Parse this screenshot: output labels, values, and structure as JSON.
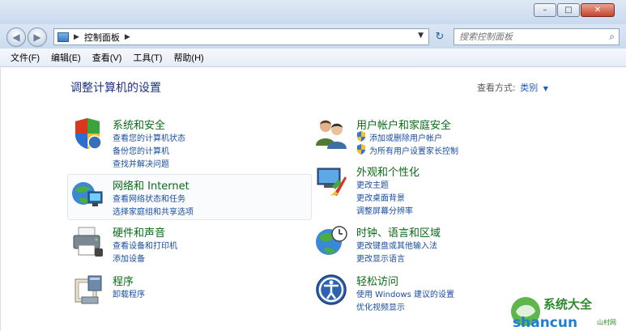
{
  "window": {
    "buttons": {
      "minimize": "–",
      "maximize": "□",
      "close": "✕"
    }
  },
  "address": {
    "breadcrumb": "控制面板",
    "search_placeholder": "搜索控制面板"
  },
  "menu": [
    "文件(F)",
    "编辑(E)",
    "查看(V)",
    "工具(T)",
    "帮助(H)"
  ],
  "page": {
    "title": "调整计算机的设置",
    "view_by_label": "查看方式:",
    "view_by_value": "类别"
  },
  "left": [
    {
      "title": "系统和安全",
      "icon": "shield-icon",
      "links": [
        "查看您的计算机状态",
        "备份您的计算机",
        "查找并解决问题"
      ]
    },
    {
      "title": "网络和 Internet",
      "icon": "network-icon",
      "links": [
        "查看网络状态和任务",
        "选择家庭组和共享选项"
      ]
    },
    {
      "title": "硬件和声音",
      "icon": "printer-icon",
      "links": [
        "查看设备和打印机",
        "添加设备"
      ]
    },
    {
      "title": "程序",
      "icon": "programs-icon",
      "links": [
        "卸载程序"
      ]
    }
  ],
  "right": [
    {
      "title": "用户帐户和家庭安全",
      "icon": "users-icon",
      "links": [
        "添加或删除用户帐户",
        "为所有用户设置家长控制"
      ]
    },
    {
      "title": "外观和个性化",
      "icon": "appearance-icon",
      "links": [
        "更改主题",
        "更改桌面背景",
        "调整屏幕分辨率"
      ]
    },
    {
      "title": "时钟、语言和区域",
      "icon": "globe-clock-icon",
      "links": [
        "更改键盘或其他输入法",
        "更改显示语言"
      ]
    },
    {
      "title": "轻松访问",
      "icon": "ease-of-access-icon",
      "links": [
        "使用 Windows 建议的设置",
        "优化视频显示"
      ]
    }
  ],
  "watermark": {
    "line1": "系统大全",
    "line2": "shancun",
    "small": "山村网"
  },
  "colors": {
    "heading": "#0a6b16",
    "link": "#1a4ea0",
    "title": "#1e3287"
  }
}
